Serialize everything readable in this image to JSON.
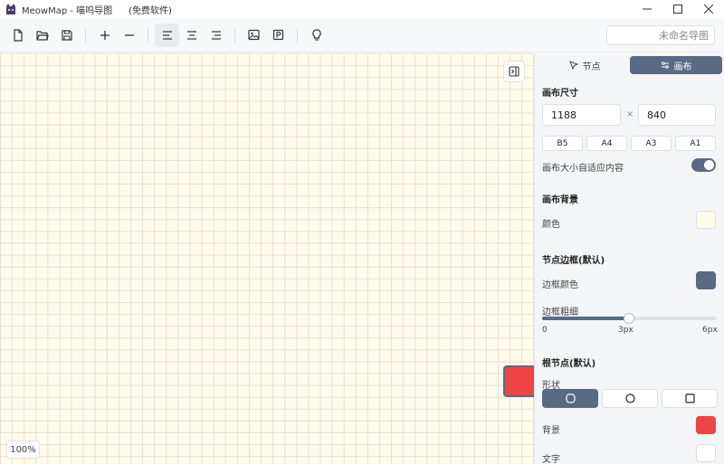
{
  "window": {
    "app_name": "MeowMap - 喵呜导图",
    "subtitle": "(免费软件)"
  },
  "toolbar": {
    "document_name": "未命名导图",
    "icons": [
      "new-file-icon",
      "open-folder-icon",
      "save-icon",
      "zoom-in-icon",
      "zoom-out-icon",
      "align-left-icon",
      "align-center-icon",
      "align-right-icon",
      "image-icon",
      "export-icon",
      "lightbulb-icon"
    ]
  },
  "canvas": {
    "zoom_label": "100%",
    "background_color": "#fffbea",
    "root_node_color": "#ef4444",
    "root_node_border": "#5a6a85"
  },
  "panel": {
    "tabs": [
      {
        "label": "节点",
        "active": false
      },
      {
        "label": "画布",
        "active": true
      }
    ],
    "canvas_size": {
      "title": "画布尺寸",
      "width": "1188",
      "height": "840",
      "times_symbol": "×",
      "presets": [
        "B5",
        "A4",
        "A3",
        "A1"
      ],
      "auto_fit_label": "画布大小自适应内容",
      "auto_fit_on": true
    },
    "canvas_background": {
      "title": "画布背景",
      "color_label": "颜色",
      "color": "#fffbea"
    },
    "node_border": {
      "title": "节点边框(默认)",
      "color_label": "边框颜色",
      "color": "#5a6a85",
      "width_label": "边框粗细",
      "width_value_fraction": 0.5,
      "ticks": [
        "0",
        "3px",
        "6px"
      ]
    },
    "root_node": {
      "title": "根节点(默认)",
      "shape_label": "形状",
      "shapes": [
        {
          "name": "rounded-rect",
          "active": true
        },
        {
          "name": "circle",
          "active": false
        },
        {
          "name": "square",
          "active": false
        }
      ],
      "background_label": "背景",
      "background_color": "#ef4444",
      "text_label": "文字",
      "text_color": "#ffffff"
    }
  },
  "colors": {
    "accent": "#5a6a85"
  }
}
